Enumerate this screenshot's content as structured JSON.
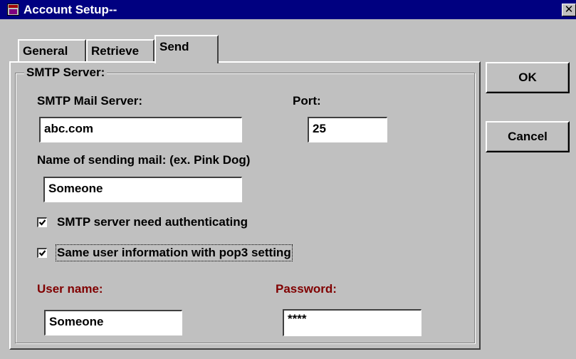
{
  "window": {
    "title": "Account Setup--",
    "close_glyph": "✕",
    "icon": "app-icon"
  },
  "tabs": [
    {
      "label": "General",
      "active": false
    },
    {
      "label": "Retrieve",
      "active": false
    },
    {
      "label": "Send",
      "active": true
    }
  ],
  "smtp_group": {
    "label": "SMTP Server:",
    "server_label": "SMTP Mail Server:",
    "server_value": "abc.com",
    "port_label": "Port:",
    "port_value": "25",
    "sender_name_label": "Name of sending mail: (ex. Pink Dog)",
    "sender_name_value": "Someone",
    "auth_checkbox": {
      "label": "SMTP server need authenticating",
      "checked": true
    },
    "same_user_checkbox": {
      "label": "Same user information with pop3 setting",
      "checked": true
    },
    "username_label": "User name:",
    "username_value": "Someone",
    "password_label": "Password:",
    "password_value": "****"
  },
  "buttons": {
    "ok_label": "OK",
    "cancel_label": "Cancel"
  },
  "colors": {
    "titlebar": "#000080",
    "face": "#c0c0c0",
    "credential_label": "#800000"
  }
}
